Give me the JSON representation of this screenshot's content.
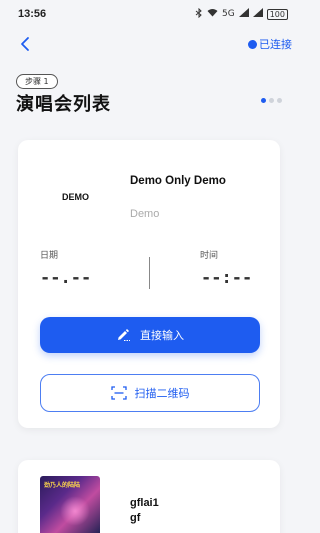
{
  "status_bar": {
    "time": "13:56",
    "network": "5G",
    "battery": "100"
  },
  "nav": {
    "connection_status": "已连接"
  },
  "step": {
    "badge": "步骤 1",
    "title": "演唱会列表",
    "pager_total": 3,
    "pager_active": 1
  },
  "concert_card": {
    "logo_text": "DEMO",
    "name": "Demo Only Demo",
    "artist": "Demo",
    "date_label": "日期",
    "date_value": "--.--",
    "time_label": "时间",
    "time_value": "--:--",
    "primary_button": "直接输入",
    "secondary_button": "扫描二维码"
  },
  "concert_card_2": {
    "thumb_text": "劲乃人的陆陆",
    "name": "gflai1\ngf"
  },
  "colors": {
    "accent": "#1e5cf0",
    "background": "#f4f5f8",
    "card": "#ffffff"
  }
}
